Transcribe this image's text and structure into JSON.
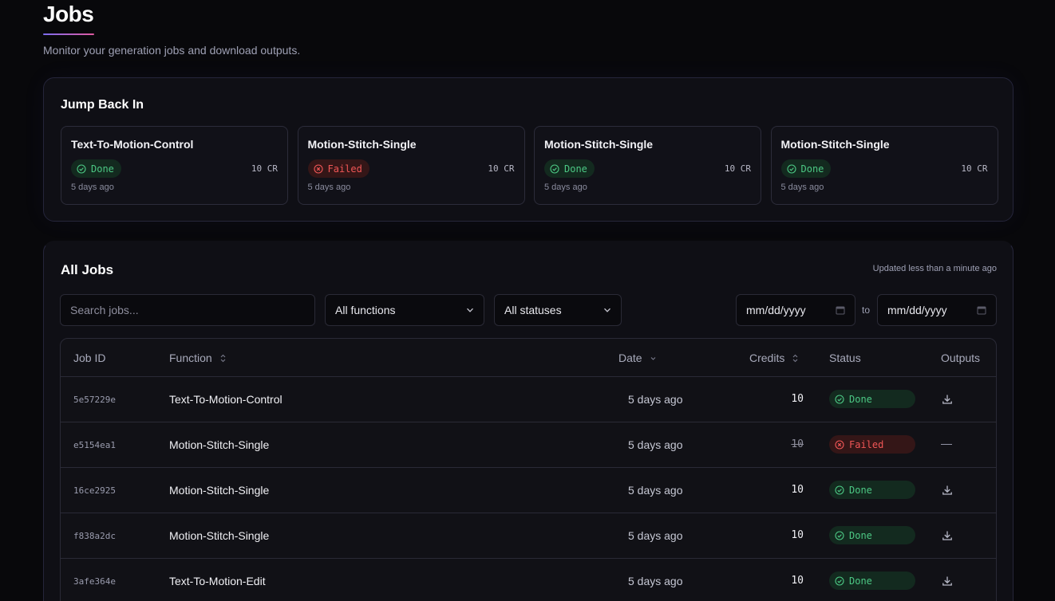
{
  "page": {
    "title": "Jobs",
    "subtitle": "Monitor your generation jobs and download outputs."
  },
  "jump_back": {
    "title": "Jump Back In",
    "cards": [
      {
        "name": "Text-To-Motion-Control",
        "status": "Done",
        "credits": "10 CR",
        "time": "5 days ago"
      },
      {
        "name": "Motion-Stitch-Single",
        "status": "Failed",
        "credits": "10 CR",
        "time": "5 days ago"
      },
      {
        "name": "Motion-Stitch-Single",
        "status": "Done",
        "credits": "10 CR",
        "time": "5 days ago"
      },
      {
        "name": "Motion-Stitch-Single",
        "status": "Done",
        "credits": "10 CR",
        "time": "5 days ago"
      }
    ]
  },
  "all_jobs": {
    "title": "All Jobs",
    "updated": "Updated less than a minute ago",
    "filters": {
      "search_placeholder": "Search jobs...",
      "function_select": "All functions",
      "status_select": "All statuses",
      "date_from": "mm/dd/yyyy",
      "date_to_label": "to",
      "date_to": "mm/dd/yyyy"
    },
    "columns": {
      "job_id": "Job ID",
      "function": "Function",
      "date": "Date",
      "credits": "Credits",
      "status": "Status",
      "outputs": "Outputs"
    },
    "rows": [
      {
        "id": "5e57229e",
        "function": "Text-To-Motion-Control",
        "date": "5 days ago",
        "credits": "10",
        "status": "Done",
        "output": "download"
      },
      {
        "id": "e5154ea1",
        "function": "Motion-Stitch-Single",
        "date": "5 days ago",
        "credits": "10",
        "status": "Failed",
        "output": "—"
      },
      {
        "id": "16ce2925",
        "function": "Motion-Stitch-Single",
        "date": "5 days ago",
        "credits": "10",
        "status": "Done",
        "output": "download"
      },
      {
        "id": "f838a2dc",
        "function": "Motion-Stitch-Single",
        "date": "5 days ago",
        "credits": "10",
        "status": "Done",
        "output": "download"
      },
      {
        "id": "3afe364e",
        "function": "Text-To-Motion-Edit",
        "date": "5 days ago",
        "credits": "10",
        "status": "Done",
        "output": "download"
      }
    ]
  },
  "colors": {
    "done": "#4cc884",
    "failed": "#f05656",
    "accent": "#7c6cf0"
  },
  "icons": {
    "done": "check-circle-icon",
    "failed": "x-circle-icon",
    "download": "download-icon",
    "chevron": "chevron-down-icon",
    "sort": "sort-icon",
    "calendar": "calendar-icon"
  }
}
